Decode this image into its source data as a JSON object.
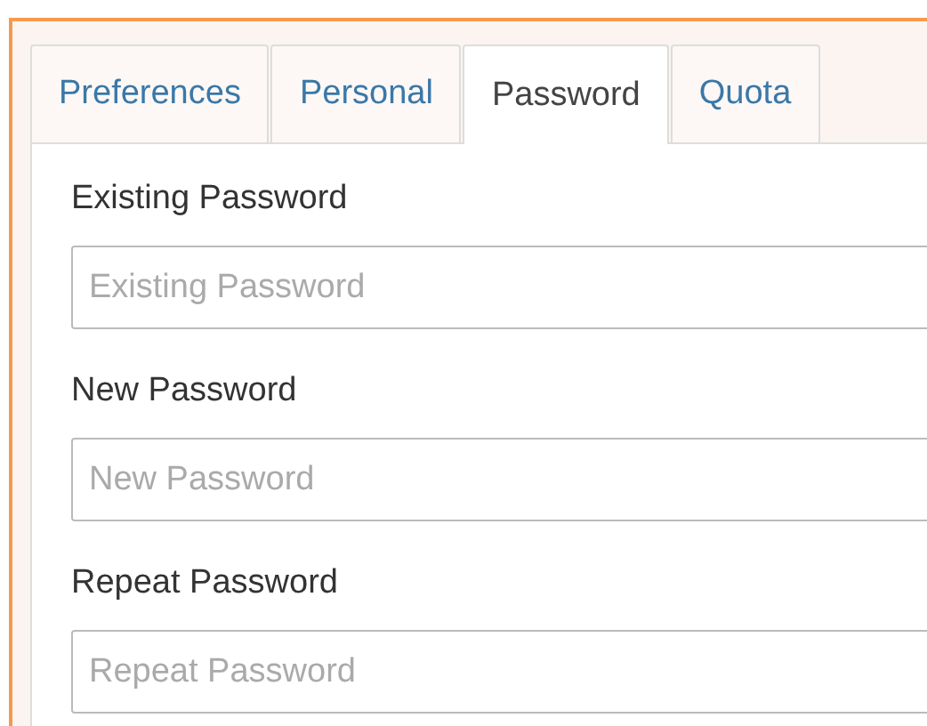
{
  "tabs": [
    {
      "label": "Preferences",
      "selected": false
    },
    {
      "label": "Personal",
      "selected": false
    },
    {
      "label": "Password",
      "selected": true
    },
    {
      "label": "Quota",
      "selected": false
    }
  ],
  "fields": [
    {
      "label": "Existing Password",
      "placeholder": "Existing Password"
    },
    {
      "label": "New Password",
      "placeholder": "New Password"
    },
    {
      "label": "Repeat Password",
      "placeholder": "Repeat Password"
    }
  ]
}
